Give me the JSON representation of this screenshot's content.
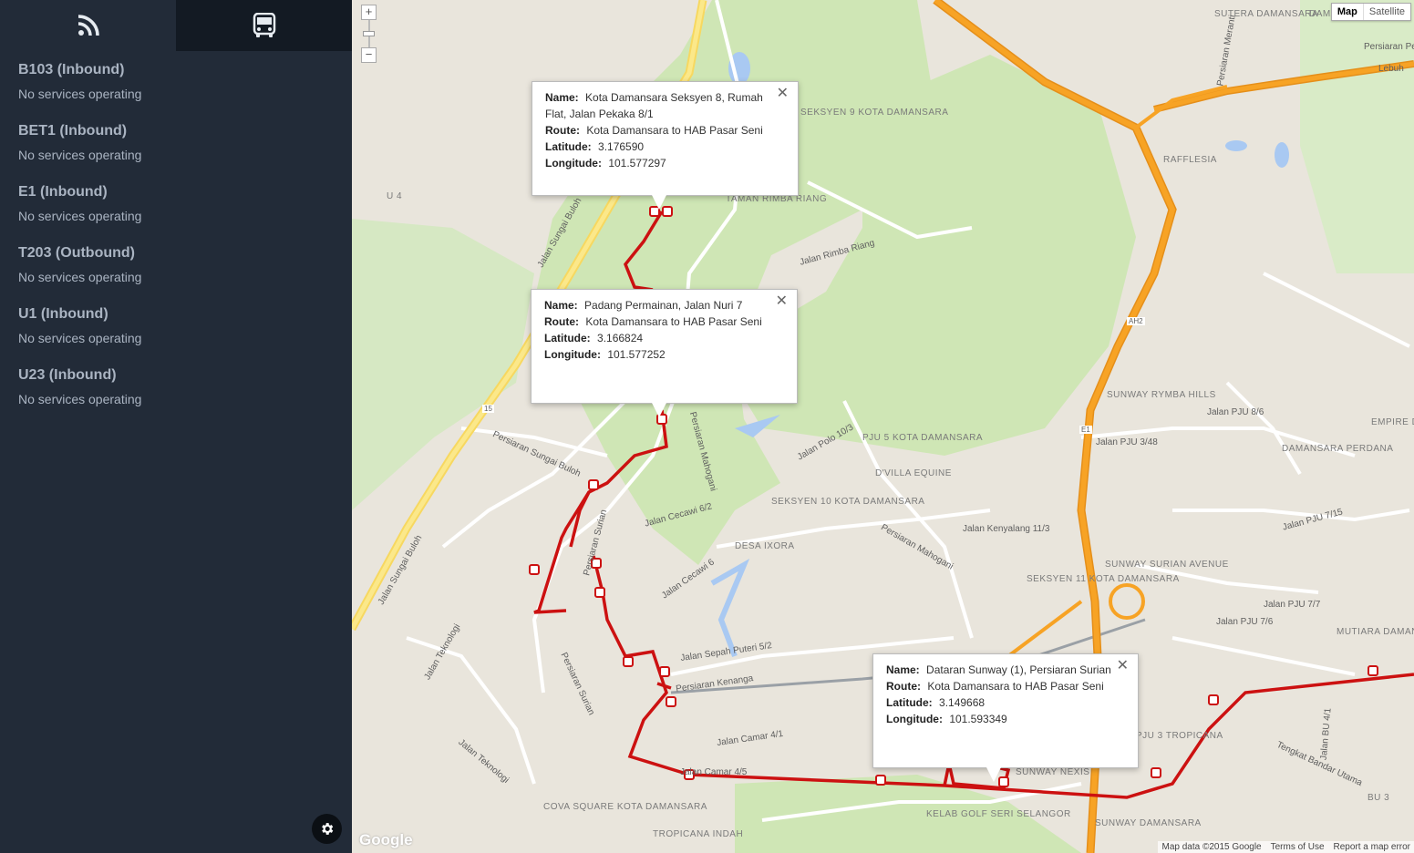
{
  "sidebar": {
    "tabs": [
      {
        "icon": "rss-icon"
      },
      {
        "icon": "bus-icon"
      }
    ],
    "routes": [
      {
        "title": "B103 (Inbound)",
        "status": "No services operating"
      },
      {
        "title": "BET1 (Inbound)",
        "status": "No services operating"
      },
      {
        "title": "E1 (Inbound)",
        "status": "No services operating"
      },
      {
        "title": "T203 (Outbound)",
        "status": "No services operating"
      },
      {
        "title": "U1 (Inbound)",
        "status": "No services operating"
      },
      {
        "title": "U23 (Inbound)",
        "status": "No services operating"
      }
    ],
    "settings_icon": "gear-icon"
  },
  "map": {
    "zoom_in": "+",
    "zoom_out": "−",
    "map_types": {
      "map": "Map",
      "satellite": "Satellite"
    },
    "popups": [
      {
        "name_label": "Name:",
        "name": "Kota Damansara Seksyen 8, Rumah Flat, Jalan Pekaka 8/1",
        "route_label": "Route:",
        "route": "Kota Damansara to HAB Pasar Seni",
        "lat_label": "Latitude:",
        "lat": "3.176590",
        "lon_label": "Longitude:",
        "lon": "101.577297"
      },
      {
        "name_label": "Name:",
        "name": "Padang Permainan, Jalan Nuri 7",
        "route_label": "Route:",
        "route": "Kota Damansara to HAB Pasar Seni",
        "lat_label": "Latitude:",
        "lat": "3.166824",
        "lon_label": "Longitude:",
        "lon": "101.577252"
      },
      {
        "name_label": "Name:",
        "name": "Dataran Sunway (1), Persiaran Surian",
        "route_label": "Route:",
        "route": "Kota Damansara to HAB Pasar Seni",
        "lat_label": "Latitude:",
        "lat": "3.149668",
        "lon_label": "Longitude:",
        "lon": "101.593349"
      }
    ],
    "labels": {
      "sutera": "SUTERA DAMANSARA",
      "damansara_damai": "DAMANSARA DAMAI",
      "seksyen9": "SEKSYEN 9 KOTA DAMANSARA",
      "taman_rimba": "TAMAN RIMBA RIANG",
      "rafflesia": "RAFFLESIA",
      "sunway_rymba": "SUNWAY RYMBA HILLS",
      "damansara_perdana": "DAMANSARA PERDANA",
      "empire": "EMPIRE DAMANSARA",
      "pju5": "PJU 5 KOTA DAMANSARA",
      "dvilla": "D'VILLA EQUINE",
      "seksyen10": "SEKSYEN 10 KOTA DAMANSARA",
      "desa_ixora": "DESA IXORA",
      "seksyen11": "SEKSYEN 11 KOTA DAMANSARA",
      "sunway_surian": "SUNWAY SURIAN AVENUE",
      "mutiara": "MUTIARA DAMANSARA",
      "pju3": "PJU 3 TROPICANA",
      "sunway_nexis": "SUNWAY NEXIS",
      "sunway_damansara": "SUNWAY DAMANSARA",
      "kelab_golf": "KELAB GOLF SERI SELANGOR",
      "cova": "COVA SQUARE KOTA DAMANSARA",
      "tropicana_indah": "TROPICANA INDAH",
      "jalan_sungai_buloh": "Jalan Sungai Buloh",
      "jalan_sungai_buloh2": "Jalan Sungai Buloh",
      "persiaran_sungai_buloh": "Persiaran Sungai Buloh",
      "persiaran_mahogani": "Persiaran Mahogani",
      "persiaran_mahogani2": "Persiaran Mahogani",
      "persiaran_surian": "Persiaran Surian",
      "persiaran_surian2": "Persiaran Surian",
      "persiaran_kenanga": "Persiaran Kenanga",
      "jalan_teknologi": "Jalan Teknologi",
      "jalan_teknologi2": "Jalan Teknologi",
      "jalan_sepah_puteri": "Jalan Sepah Puteri 5/2",
      "jalan_cecawi": "Jalan Cecawi 6/2",
      "jalan_cecawi6": "Jalan Cecawi 6",
      "jalan_polo": "Jalan Polo 10/3",
      "jalan_kenyalang": "Jalan Kenyalang 11/3",
      "jalan_rimba": "Jalan Rimba Riang",
      "jalan_pju3_48": "Jalan PJU 3/48",
      "jalan_pju8_6": "Jalan PJU 8/6",
      "jalan_pju7_7": "Jalan PJU 7/7",
      "jalan_pju7_15": "Jalan PJU 7/15",
      "jalan_pju7_6": "Jalan PJU 7/6",
      "persiaran_meranti": "Persiaran Meranti",
      "jalan_bu": "Jalan BU 4/1",
      "tengkat": "Tengkat Bandar Utama",
      "bu3": "BU 3",
      "jalan_camar": "Jalan Camar 4/1",
      "jalan_camar45": "Jalan Camar 4/5",
      "ah2": "AH2",
      "e1": "E1",
      "r15": "15",
      "u4": "U 4",
      "lebuh": "Lebuh",
      "persiaran_pen": "Persiaran Pen"
    },
    "footer": {
      "map_data": "Map data ©2015 Google",
      "terms": "Terms of Use",
      "report": "Report a map error"
    },
    "logo": "Google",
    "colors": {
      "route": "#cc1111",
      "highway": "#f7a325",
      "park": "#cfe6b5",
      "water": "#a9c9f2"
    }
  }
}
